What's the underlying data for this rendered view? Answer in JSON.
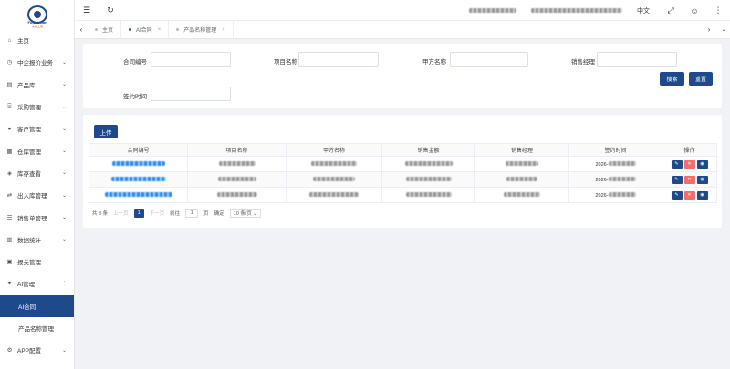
{
  "logo": {
    "text": "Future Nan",
    "sub": "未来之南"
  },
  "sidebar": {
    "items": [
      {
        "label": "主页",
        "icon": "home-icon",
        "glyph": "⌂",
        "chevron": false
      },
      {
        "label": "中企报价业务",
        "icon": "clock-icon",
        "glyph": "◷",
        "chevron": true
      },
      {
        "label": "产品库",
        "icon": "package-icon",
        "glyph": "▤",
        "chevron": true
      },
      {
        "label": "采购管理",
        "icon": "cart-icon",
        "glyph": "⌸",
        "chevron": true
      },
      {
        "label": "客户管理",
        "icon": "user-icon",
        "glyph": "●",
        "chevron": true
      },
      {
        "label": "仓库管理",
        "icon": "warehouse-icon",
        "glyph": "▦",
        "chevron": true
      },
      {
        "label": "库存查看",
        "icon": "inventory-icon",
        "glyph": "◈",
        "chevron": true
      },
      {
        "label": "出入库管理",
        "icon": "transfer-icon",
        "glyph": "⇄",
        "chevron": true
      },
      {
        "label": "销售单管理",
        "icon": "order-icon",
        "glyph": "☰",
        "chevron": true
      },
      {
        "label": "数据统计",
        "icon": "chart-icon",
        "glyph": "▥",
        "chevron": true
      },
      {
        "label": "报关管理",
        "icon": "customs-icon",
        "glyph": "▣",
        "chevron": false
      },
      {
        "label": "AI管理",
        "icon": "ai-icon",
        "glyph": "✦",
        "chevron": true,
        "chevron_up": true
      },
      {
        "label": "AI合同",
        "sub": true,
        "active": true
      },
      {
        "label": "产品名称管理",
        "sub": true
      },
      {
        "label": "APP配置",
        "icon": "app-icon",
        "glyph": "⚙",
        "chevron": true
      },
      {
        "label": "系统管理",
        "icon": "settings-icon",
        "glyph": "⚙",
        "chevron": true
      }
    ]
  },
  "header": {
    "lang": "中文"
  },
  "tabs": [
    {
      "label": "主页",
      "active": false,
      "closable": false
    },
    {
      "label": "AI合同",
      "active": true,
      "closable": true
    },
    {
      "label": "产品名称管理",
      "active": false,
      "closable": true
    }
  ],
  "search": {
    "contract_no_label": "合同编号",
    "project_name_label": "项目名称",
    "party_a_label": "甲方名称",
    "sales_manager_label": "销售经理",
    "sign_date_label": "签约时间",
    "search_button": "搜索",
    "reset_button": "重置"
  },
  "table": {
    "upload_button": "上传",
    "columns": [
      "合同编号",
      "项目名称",
      "甲方名称",
      "销售金额",
      "销售经理",
      "签约时间",
      "操作"
    ],
    "rows": [
      {
        "date": "2026-"
      },
      {
        "date": "2026-"
      },
      {
        "date": "2026-"
      }
    ],
    "actions": {
      "edit": "✎",
      "delete": "✕",
      "view": "◉"
    }
  },
  "pager": {
    "total": "共 3 条",
    "prev": "上一页",
    "current": "1",
    "next": "下一页",
    "goto": "前往",
    "page_input": "1",
    "page_unit": "页",
    "confirm": "确定",
    "page_size": "10 条/页 ⌄"
  },
  "colors": {
    "primary": "#1e4a8c",
    "danger": "#f56c6c",
    "link": "#2d8cf0"
  }
}
